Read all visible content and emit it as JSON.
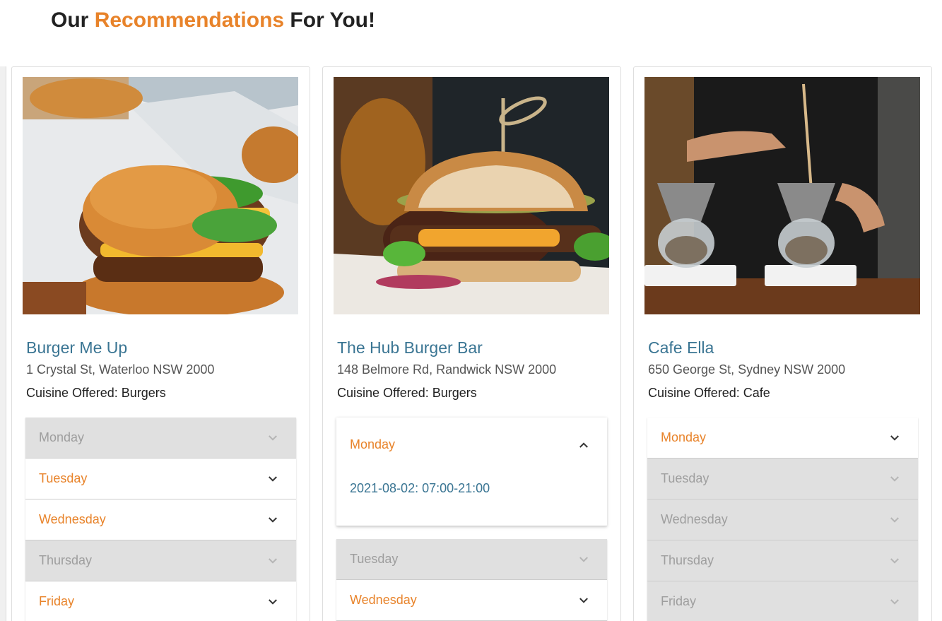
{
  "header": {
    "prefix": "Our",
    "highlight": "Recommendations",
    "suffix": "For You!"
  },
  "colors": {
    "accent": "#e8832a",
    "link": "#3a7593",
    "disabled_bg": "#e0e0e0",
    "disabled_text": "#9e9e9e"
  },
  "cards": [
    {
      "name": "Burger Me Up",
      "address": "1 Crystal St, Waterloo NSW 2000",
      "cuisine": "Cuisine Offered: Burgers",
      "days": [
        {
          "label": "Monday",
          "state": "disabled"
        },
        {
          "label": "Tuesday",
          "state": "collapsed"
        },
        {
          "label": "Wednesday",
          "state": "collapsed"
        },
        {
          "label": "Thursday",
          "state": "disabled"
        },
        {
          "label": "Friday",
          "state": "collapsed"
        }
      ]
    },
    {
      "name": "The Hub Burger Bar",
      "address": "148 Belmore Rd, Randwick NSW 2000",
      "cuisine": "Cuisine Offered: Burgers",
      "days": [
        {
          "label": "Monday",
          "state": "expanded",
          "hours": "2021-08-02: 07:00-21:00"
        },
        {
          "label": "Tuesday",
          "state": "disabled"
        },
        {
          "label": "Wednesday",
          "state": "collapsed"
        }
      ]
    },
    {
      "name": "Cafe Ella",
      "address": "650 George St, Sydney NSW 2000",
      "cuisine": "Cuisine Offered: Cafe",
      "days": [
        {
          "label": "Monday",
          "state": "collapsed"
        },
        {
          "label": "Tuesday",
          "state": "disabled"
        },
        {
          "label": "Wednesday",
          "state": "disabled"
        },
        {
          "label": "Thursday",
          "state": "disabled"
        },
        {
          "label": "Friday",
          "state": "disabled"
        }
      ]
    }
  ]
}
